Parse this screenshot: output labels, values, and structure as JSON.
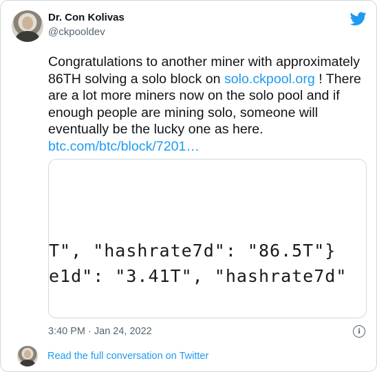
{
  "tweet": {
    "author_name": "Dr. Con Kolivas",
    "author_handle": "@ckpooldev",
    "text_part1": "Congratulations to another miner with approximately 86TH solving a solo block on ",
    "link1": "solo.ckpool.org",
    "text_part2": " ! There are a lot more miners now on the solo pool and if enough people are mining solo, someone will eventually be the lucky one as here. ",
    "link2": "btc.com/btc/block/7201…",
    "timestamp": "3:40 PM · Jan 24, 2022"
  },
  "media": {
    "line1": "T\", \"hashrate7d\": \"86.5T\"}",
    "line2": "e1d\": \"3.41T\", \"hashrate7d\""
  },
  "footer": {
    "conversation_link": "Read the full conversation on Twitter"
  },
  "icons": {
    "brand": "twitter-bird-icon",
    "info": "info-icon"
  },
  "colors": {
    "accent": "#1d9bf0",
    "muted": "#536471",
    "text": "#0f1419",
    "border": "#cfd9de"
  }
}
